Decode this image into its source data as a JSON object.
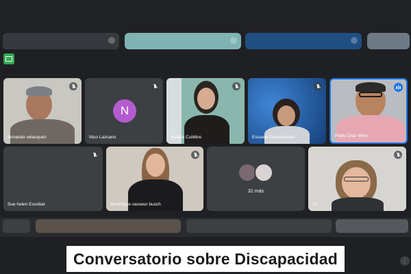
{
  "participants": [
    {
      "name": "fernando velasquez",
      "muted": true
    },
    {
      "name": "Nico Lazcano",
      "initial": "N",
      "muted": true
    },
    {
      "name": "Natalia Cubillos",
      "muted": true
    },
    {
      "name": "Escuela Construcción",
      "muted": true
    },
    {
      "name": "Pablo Díaz Mery",
      "speaking": true
    },
    {
      "name": "Sue helen Escobar",
      "muted": true
    },
    {
      "name": "dominique vasseur busch",
      "muted": true
    },
    {
      "name": "31 más"
    },
    {
      "name": "Tú",
      "muted": true
    }
  ],
  "caption": "Conversatorio sobre Discapacidad",
  "colors": {
    "avatar_n": "#b45bd0",
    "active_speaker": "#1a73e8",
    "tile": "#3c4043",
    "background": "#1f2023"
  }
}
